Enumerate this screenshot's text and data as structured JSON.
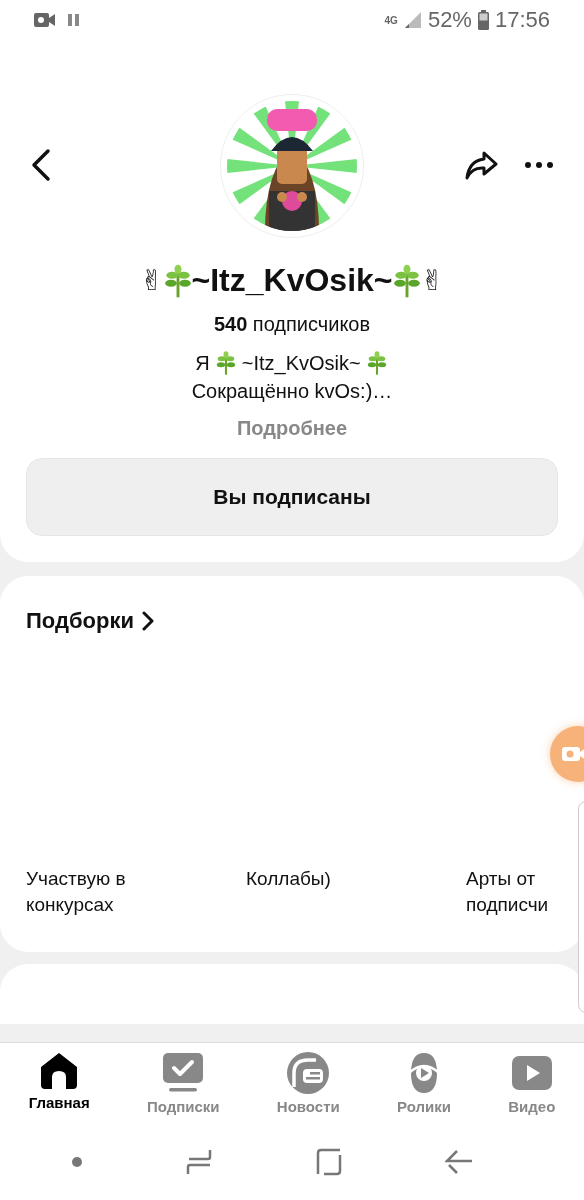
{
  "status_bar": {
    "network": "4G",
    "battery": "52%",
    "time": "17:56"
  },
  "profile": {
    "name_mark": "✌",
    "name": "~Itz_KvOsik~",
    "followers_count": "540",
    "followers_label": "подписчиков",
    "bio_prefix": "Я",
    "bio_name": "~Itz_KvOsik~",
    "bio_line2": "Сокращённо kvOs:)…",
    "more": "Подробнее",
    "subscribe_button": "Вы подписаны"
  },
  "collections": {
    "title": "Подборки",
    "items": [
      {
        "title": "Участвую в конкурсах"
      },
      {
        "title": "Коллабы)"
      },
      {
        "title": "Арты от подписчи"
      }
    ]
  },
  "bottom_nav": [
    {
      "label": "Главная",
      "selected": true
    },
    {
      "label": "Подписки",
      "selected": false
    },
    {
      "label": "Новости",
      "selected": false
    },
    {
      "label": "Ролики",
      "selected": false
    },
    {
      "label": "Видео",
      "selected": false
    }
  ]
}
